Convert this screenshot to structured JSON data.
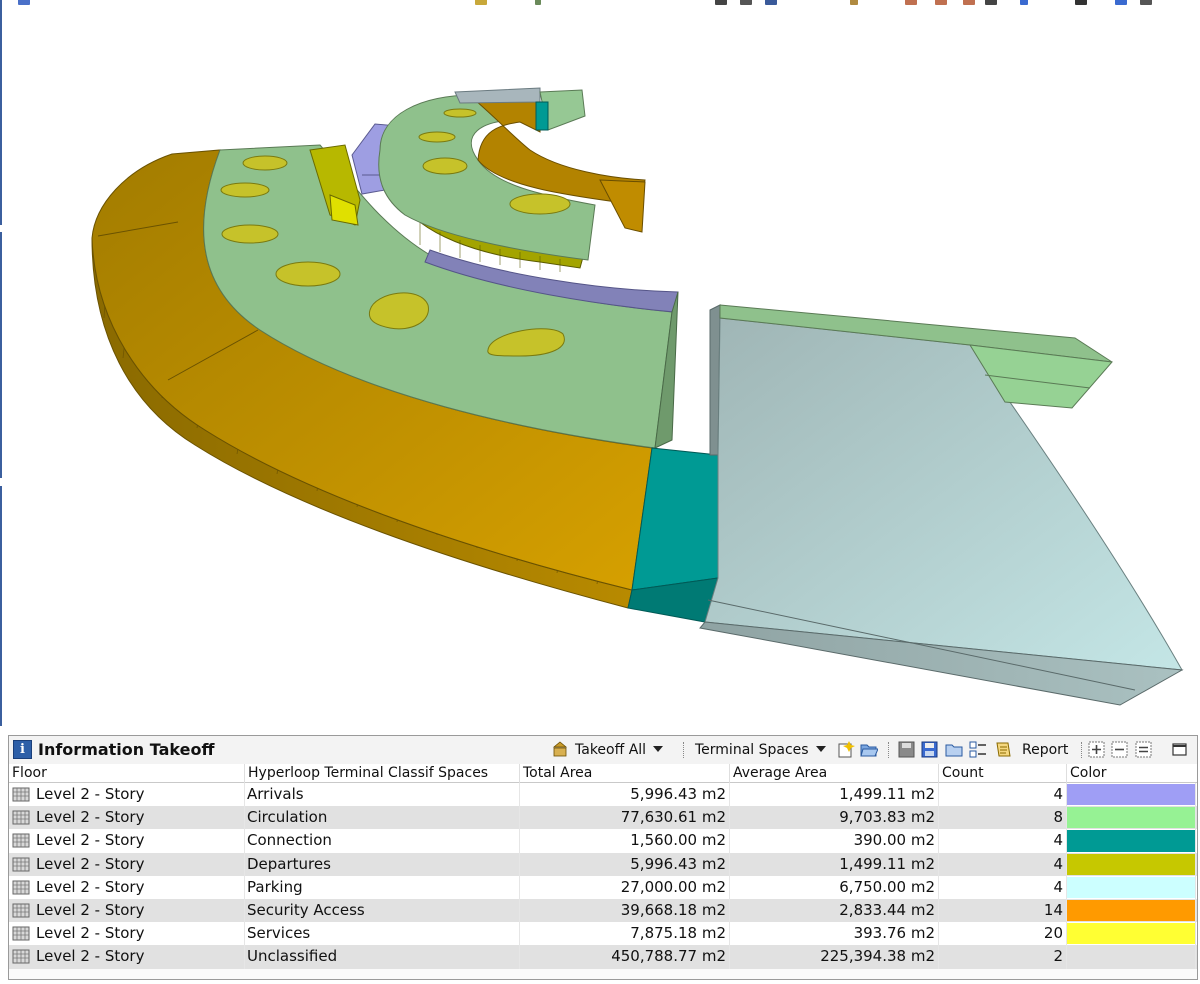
{
  "panel": {
    "title": "Information Takeoff",
    "takeoff_all_label": "Takeoff All",
    "preset_label": "Terminal Spaces",
    "report_label": "Report"
  },
  "table": {
    "headers": [
      "Floor",
      "Hyperloop Terminal Classif Spaces",
      "Total Area",
      "Average Area",
      "Count",
      "Color"
    ],
    "rows": [
      {
        "floor": "Level 2 - Story",
        "space": "Arrivals",
        "total": "5,996.43 m2",
        "avg": "1,499.11 m2",
        "count": "4",
        "color": "#9f9ef5"
      },
      {
        "floor": "Level 2 - Story",
        "space": "Circulation",
        "total": "77,630.61 m2",
        "avg": "9,703.83 m2",
        "count": "8",
        "color": "#96f294"
      },
      {
        "floor": "Level 2 - Story",
        "space": "Connection",
        "total": "1,560.00 m2",
        "avg": "390.00 m2",
        "count": "4",
        "color": "#009a94"
      },
      {
        "floor": "Level 2 - Story",
        "space": "Departures",
        "total": "5,996.43 m2",
        "avg": "1,499.11 m2",
        "count": "4",
        "color": "#c6c800"
      },
      {
        "floor": "Level 2 - Story",
        "space": "Parking",
        "total": "27,000.00 m2",
        "avg": "6,750.00 m2",
        "count": "4",
        "color": "#ccffff"
      },
      {
        "floor": "Level 2 - Story",
        "space": "Security Access",
        "total": "39,668.18 m2",
        "avg": "2,833.44 m2",
        "count": "14",
        "color": "#ff9a00"
      },
      {
        "floor": "Level 2 - Story",
        "space": "Services",
        "total": "7,875.18 m2",
        "avg": "393.76 m2",
        "count": "20",
        "color": "#ffff33"
      },
      {
        "floor": "Level 2 - Story",
        "space": "Unclassified",
        "total": "450,788.77 m2",
        "avg": "225,394.38 m2",
        "count": "2",
        "color": "#e1e1e1"
      }
    ]
  },
  "icons": [
    "info-icon",
    "takeoff-icon",
    "new-preset-icon",
    "open-preset-icon",
    "save-icon",
    "save-as-icon",
    "folder-icon",
    "checklist-icon",
    "report-icon",
    "expand-all-icon",
    "collapse-all-icon",
    "equal-icon",
    "maximize-icon",
    "floor-icon"
  ]
}
